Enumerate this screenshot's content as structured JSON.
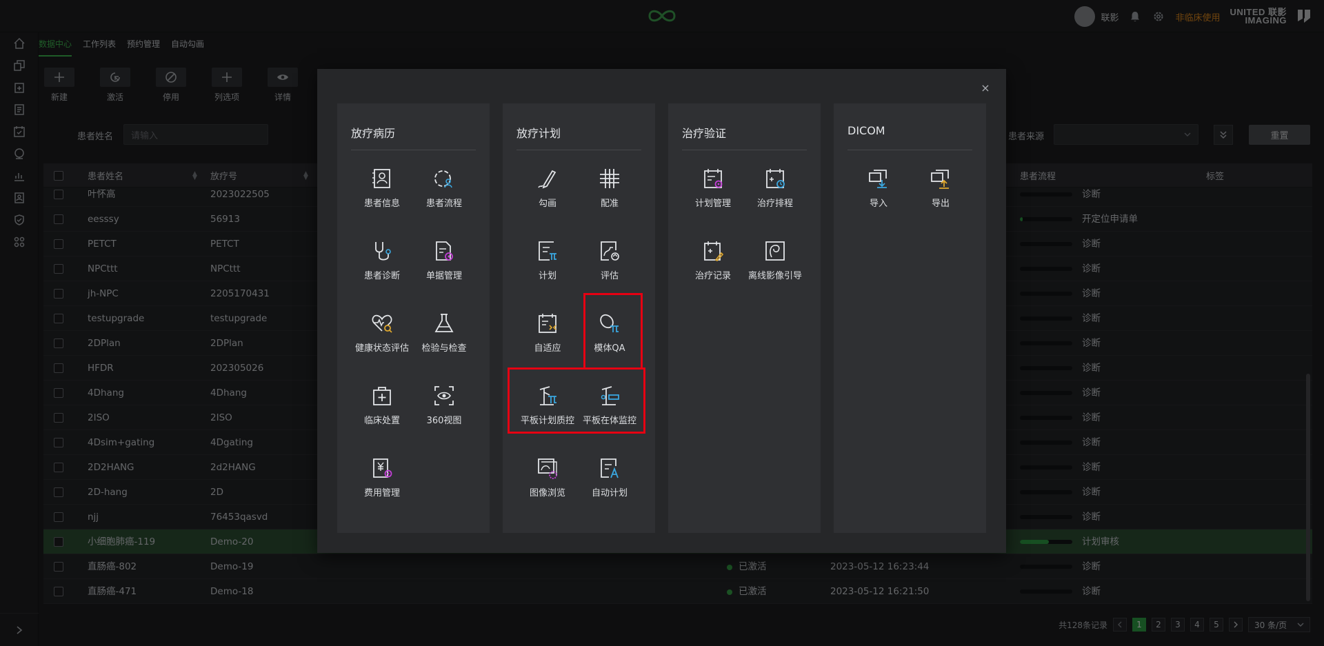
{
  "topbar": {
    "user_name": "联影",
    "nonclinical": "非临床使用",
    "brand_line1": "UNITED 联影",
    "brand_line2": "IMAGING"
  },
  "subtabs": [
    "数据中心",
    "工作列表",
    "预约管理",
    "自动勾画"
  ],
  "toolbar": [
    "新建",
    "激活",
    "停用",
    "列选项",
    "详情"
  ],
  "filters": {
    "patient_name_label": "患者姓名",
    "patient_name_placeholder": "请输入",
    "patient_source_label": "患者来源",
    "reset_label": "重置"
  },
  "table": {
    "columns": [
      "患者姓名",
      "放疗号",
      "患者流程",
      "标签"
    ],
    "rows": [
      {
        "name": "叶怀高",
        "id": "2023022505",
        "status": "",
        "time": "",
        "progress": 0,
        "flow": "诊断"
      },
      {
        "name": "eesssy",
        "id": "56913",
        "status": "",
        "time": "",
        "progress": 0.05,
        "flow": "开定位申请单"
      },
      {
        "name": "PETCT",
        "id": "PETCT",
        "status": "",
        "time": "",
        "progress": 0,
        "flow": "诊断"
      },
      {
        "name": "NPCttt",
        "id": "NPCttt",
        "status": "",
        "time": "",
        "progress": 0,
        "flow": "诊断"
      },
      {
        "name": "jh-NPC",
        "id": "2205170431",
        "status": "",
        "time": "",
        "progress": 0,
        "flow": "诊断"
      },
      {
        "name": "testupgrade",
        "id": "testupgrade",
        "status": "",
        "time": "",
        "progress": 0,
        "flow": "诊断"
      },
      {
        "name": "2DPlan",
        "id": "2DPlan",
        "status": "",
        "time": "",
        "progress": 0,
        "flow": "诊断"
      },
      {
        "name": "HFDR",
        "id": "202305026",
        "status": "",
        "time": "",
        "progress": 0,
        "flow": "诊断"
      },
      {
        "name": "4Dhang",
        "id": "4Dhang",
        "status": "",
        "time": "",
        "progress": 0,
        "flow": "诊断"
      },
      {
        "name": "2ISO",
        "id": "2ISO",
        "status": "",
        "time": "",
        "progress": 0,
        "flow": "诊断"
      },
      {
        "name": "4Dsim+gating",
        "id": "4Dgating",
        "status": "",
        "time": "",
        "progress": 0,
        "flow": "诊断"
      },
      {
        "name": "2D2HANG",
        "id": "2d2HANG",
        "status": "",
        "time": "",
        "progress": 0,
        "flow": "诊断"
      },
      {
        "name": "2D-hang",
        "id": "2D",
        "status": "",
        "time": "",
        "progress": 0,
        "flow": "诊断"
      },
      {
        "name": "njj",
        "id": "76453qasvd",
        "status": "",
        "time": "",
        "progress": 0,
        "flow": "诊断"
      },
      {
        "name": "小细胞肺癌-119",
        "id": "Demo-20",
        "status": "",
        "time": "",
        "progress": 0.55,
        "flow": "计划审核",
        "selected": true
      },
      {
        "name": "直肠癌-802",
        "id": "Demo-19",
        "status": "已激活",
        "time": "2023-05-12 16:23:44",
        "progress": 0,
        "flow": "诊断"
      },
      {
        "name": "直肠癌-471",
        "id": "Demo-18",
        "status": "已激活",
        "time": "2023-05-12 16:21:50",
        "progress": 0,
        "flow": "诊断"
      }
    ]
  },
  "pagination": {
    "total": "共128条记录",
    "pages": [
      "1",
      "2",
      "3",
      "4",
      "5"
    ],
    "current": "1",
    "page_size": "30 条/页"
  },
  "modal": {
    "panels": [
      {
        "title": "放疗病历",
        "apps": [
          "患者信息",
          "患者流程",
          "患者诊断",
          "单据管理",
          "健康状态评估",
          "检验与检查",
          "临床处置",
          "360视图",
          "费用管理"
        ]
      },
      {
        "title": "放疗计划",
        "apps": [
          "勾画",
          "配准",
          "计划",
          "评估",
          "自适应",
          "模体QA",
          "平板计划质控",
          "平板在体监控",
          "图像浏览",
          "自动计划"
        ]
      },
      {
        "title": "治疗验证",
        "apps": [
          "计划管理",
          "治疗排程",
          "治疗记录",
          "离线影像引导"
        ]
      },
      {
        "title": "DICOM",
        "apps": [
          "导入",
          "导出"
        ]
      }
    ]
  },
  "colors": {
    "accent": "#2f9e44",
    "highlight": "#e60012",
    "warning": "#e38a1d"
  }
}
